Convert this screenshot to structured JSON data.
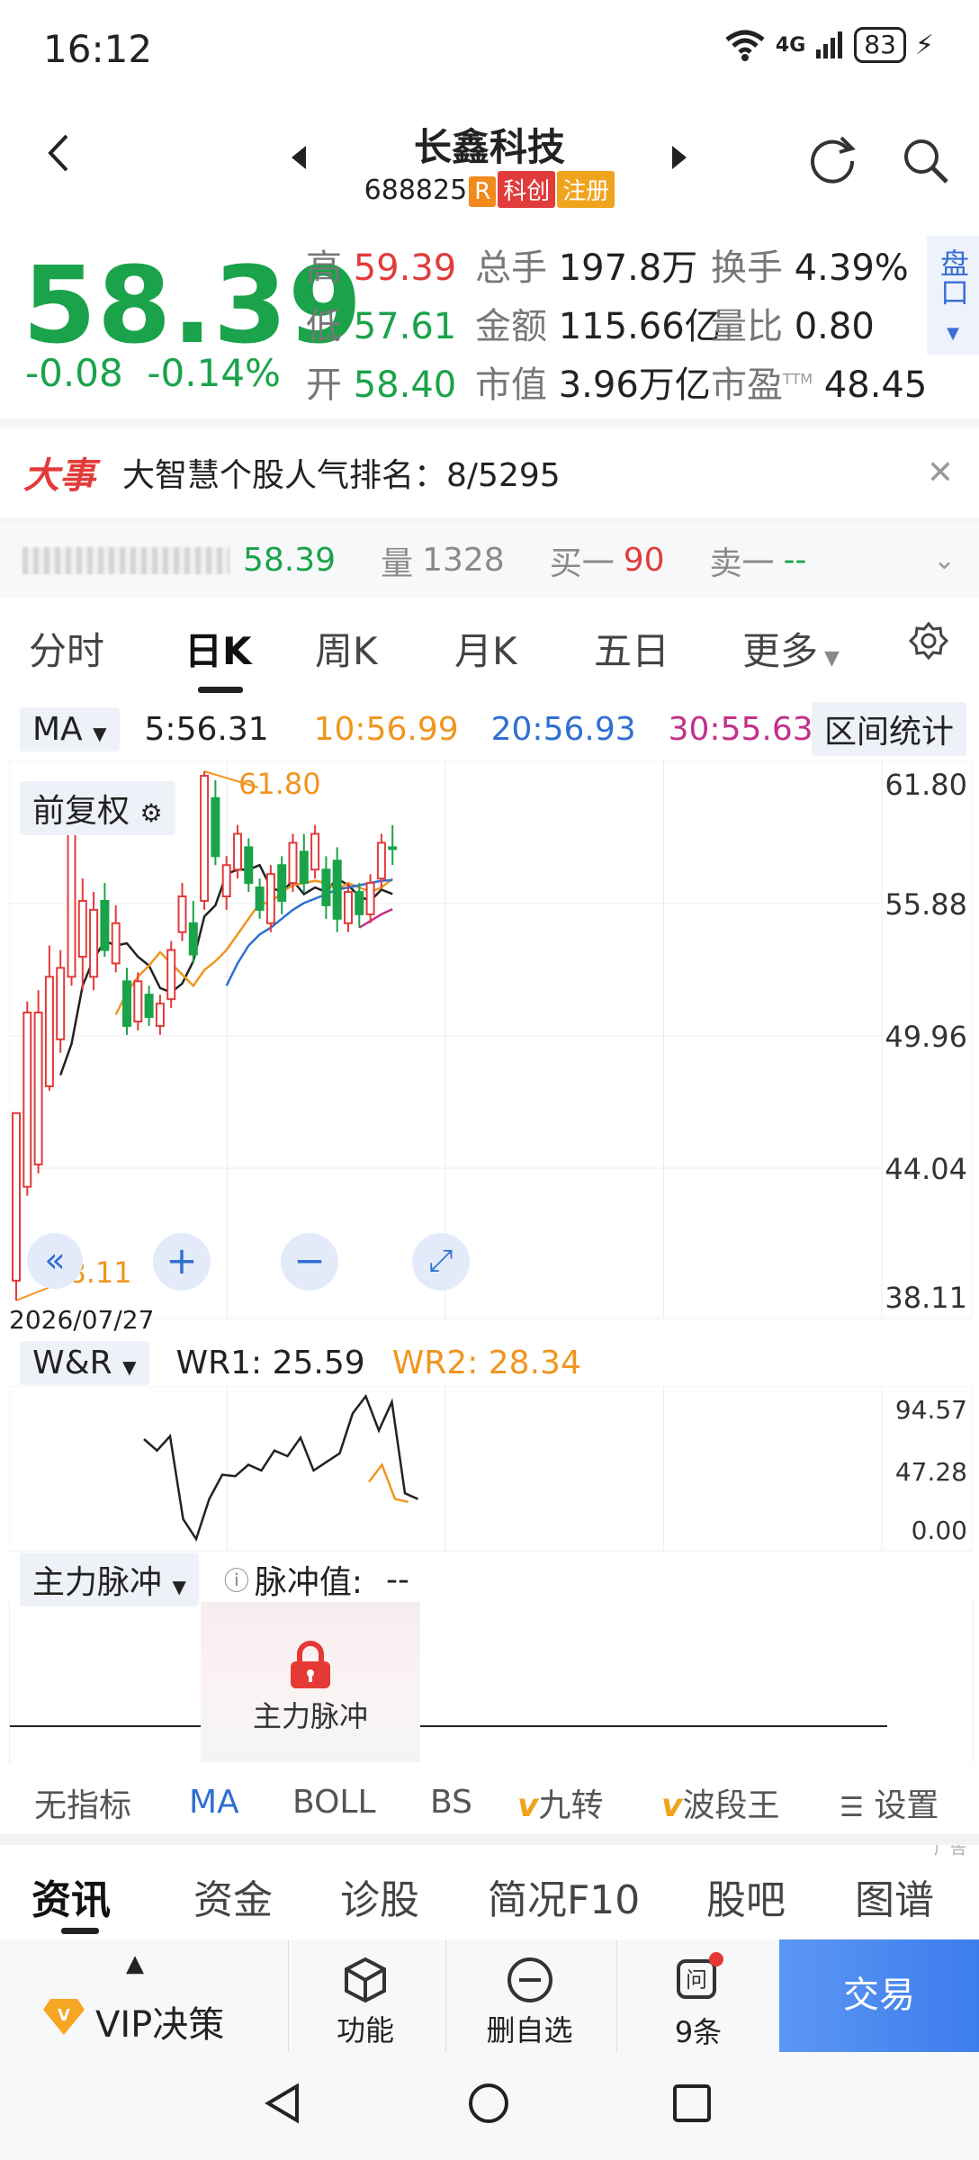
{
  "status": {
    "time": "16:12",
    "signal_top": "6",
    "network": "4G",
    "battery": "83"
  },
  "header": {
    "title": "长鑫科技",
    "code": "688825",
    "tags": [
      "R",
      "科创",
      "注册"
    ]
  },
  "quote": {
    "price": "58.39",
    "change": "-0.08",
    "change_pct": "-0.14%",
    "high_label": "高",
    "high": "59.39",
    "low_label": "低",
    "low": "57.61",
    "open_label": "开",
    "open": "58.40",
    "volume_label": "总手",
    "volume": "197.8万",
    "amount_label": "金额",
    "amount": "115.66亿",
    "mktcap_label": "市值",
    "mktcap": "3.96万亿",
    "turnover_label": "换手",
    "turnover": "4.39%",
    "vol_ratio_label": "量比",
    "vol_ratio": "0.80",
    "pe_label": "市盈",
    "pe_sup": "TTM",
    "pe": "48.45",
    "pankou": "盘口"
  },
  "news": {
    "badge": "大事",
    "text": "大智慧个股人气排名：8/5295"
  },
  "tick": {
    "price": "58.39",
    "vol_label": "量",
    "vol": "1328",
    "buy_label": "买一",
    "buy": "90",
    "sell_label": "卖一",
    "sell": "--"
  },
  "tabs": [
    "分时",
    "日K",
    "周K",
    "月K",
    "五日",
    "更多"
  ],
  "ma_row": {
    "indicator": "MA",
    "ma5": "5:56.31",
    "ma10": "10:56.99",
    "ma20": "20:56.93",
    "ma30": "30:55.63",
    "range_stat": "区间统计"
  },
  "chart": {
    "adjust": "前复权",
    "high_mark": "61.80",
    "low_mark": "38.11",
    "date": "2026/07/27",
    "yticks": [
      "61.80",
      "55.88",
      "49.96",
      "44.04",
      "38.11"
    ]
  },
  "chart_data": {
    "type": "candlestick",
    "ylim": [
      38.11,
      61.8
    ],
    "candles": [
      {
        "o": 39.0,
        "c": 46.5,
        "h": 46.5,
        "l": 38.11
      },
      {
        "o": 43.2,
        "c": 51.0,
        "h": 51.5,
        "l": 42.8
      },
      {
        "o": 44.2,
        "c": 51.0,
        "h": 52.0,
        "l": 43.8
      },
      {
        "o": 47.7,
        "c": 52.6,
        "h": 54.0,
        "l": 47.5
      },
      {
        "o": 49.8,
        "c": 53.0,
        "h": 53.8,
        "l": 49.2
      },
      {
        "o": 52.6,
        "c": 59.0,
        "h": 59.2,
        "l": 52.2
      },
      {
        "o": 53.5,
        "c": 56.0,
        "h": 57.0,
        "l": 52.0
      },
      {
        "o": 52.6,
        "c": 55.6,
        "h": 56.4,
        "l": 52.0
      },
      {
        "o": 56.0,
        "c": 53.8,
        "h": 56.8,
        "l": 53.5
      },
      {
        "o": 53.2,
        "c": 55.0,
        "h": 55.8,
        "l": 52.8
      },
      {
        "o": 52.4,
        "c": 50.4,
        "h": 53.0,
        "l": 50.0
      },
      {
        "o": 50.6,
        "c": 52.4,
        "h": 52.8,
        "l": 50.2
      },
      {
        "o": 51.8,
        "c": 50.8,
        "h": 52.2,
        "l": 50.4
      },
      {
        "o": 50.4,
        "c": 51.4,
        "h": 51.8,
        "l": 50.0
      },
      {
        "o": 51.6,
        "c": 53.8,
        "h": 54.2,
        "l": 51.2
      },
      {
        "o": 54.6,
        "c": 56.2,
        "h": 56.8,
        "l": 54.2
      },
      {
        "o": 55.0,
        "c": 53.6,
        "h": 56.0,
        "l": 53.2
      },
      {
        "o": 56.0,
        "c": 61.6,
        "h": 61.8,
        "l": 55.6
      },
      {
        "o": 60.6,
        "c": 58.0,
        "h": 61.4,
        "l": 57.6
      },
      {
        "o": 56.2,
        "c": 57.6,
        "h": 58.0,
        "l": 55.6
      },
      {
        "o": 57.4,
        "c": 59.0,
        "h": 59.4,
        "l": 57.0
      },
      {
        "o": 58.4,
        "c": 56.8,
        "h": 58.8,
        "l": 56.4
      },
      {
        "o": 56.6,
        "c": 55.6,
        "h": 57.0,
        "l": 55.2
      },
      {
        "o": 55.0,
        "c": 57.2,
        "h": 57.6,
        "l": 54.6
      },
      {
        "o": 57.6,
        "c": 56.0,
        "h": 58.0,
        "l": 55.4
      },
      {
        "o": 56.8,
        "c": 58.6,
        "h": 59.0,
        "l": 56.4
      },
      {
        "o": 58.2,
        "c": 56.8,
        "h": 59.0,
        "l": 56.4
      },
      {
        "o": 57.4,
        "c": 59.0,
        "h": 59.4,
        "l": 57.0
      },
      {
        "o": 57.4,
        "c": 55.8,
        "h": 58.0,
        "l": 55.2
      },
      {
        "o": 57.8,
        "c": 55.2,
        "h": 58.4,
        "l": 54.6
      },
      {
        "o": 55.0,
        "c": 56.4,
        "h": 56.8,
        "l": 54.6
      },
      {
        "o": 56.4,
        "c": 55.4,
        "h": 56.8,
        "l": 54.8
      },
      {
        "o": 55.4,
        "c": 56.8,
        "h": 57.2,
        "l": 55.0
      },
      {
        "o": 57.0,
        "c": 58.6,
        "h": 59.0,
        "l": 56.6
      },
      {
        "o": 58.4,
        "c": 58.39,
        "h": 59.39,
        "l": 57.61
      }
    ],
    "ma5": [
      null,
      null,
      null,
      null,
      48.2,
      49.6,
      52.2,
      53.4,
      54.2,
      54.0,
      54.1,
      53.5,
      53.1,
      52.1,
      51.9,
      52.3,
      53.3,
      55.3,
      55.8,
      57.2,
      57.4,
      57.4,
      57.6,
      56.6,
      56.4,
      56.9,
      56.3,
      56.6,
      56.4,
      57.0,
      56.7,
      56.2,
      56.0,
      56.5,
      56.31
    ],
    "ma10": [
      null,
      null,
      null,
      null,
      null,
      null,
      null,
      null,
      null,
      50.9,
      51.9,
      52.6,
      53.1,
      53.7,
      53.2,
      52.7,
      52.2,
      52.9,
      53.3,
      53.8,
      54.5,
      55.2,
      55.9,
      55.9,
      56.4,
      56.7,
      56.8,
      56.9,
      56.8,
      56.5,
      56.8,
      56.6,
      56.4,
      56.6,
      56.99
    ],
    "ma20": [
      null,
      null,
      null,
      null,
      null,
      null,
      null,
      null,
      null,
      null,
      null,
      null,
      null,
      null,
      null,
      null,
      null,
      null,
      null,
      52.2,
      53.2,
      54.0,
      54.5,
      54.8,
      55.2,
      55.6,
      55.9,
      56.1,
      56.3,
      56.5,
      56.6,
      56.7,
      56.8,
      56.9,
      56.93
    ],
    "ma30": [
      null,
      null,
      null,
      null,
      null,
      null,
      null,
      null,
      null,
      null,
      null,
      null,
      null,
      null,
      null,
      null,
      null,
      null,
      null,
      null,
      null,
      null,
      null,
      null,
      null,
      null,
      null,
      null,
      null,
      null,
      null,
      54.8,
      55.1,
      55.4,
      55.63
    ],
    "wr": {
      "label": "W&R",
      "wr1_label": "WR1: ",
      "wr1": "25.59",
      "wr2_label": "WR2: ",
      "wr2": "28.34",
      "yticks": [
        "94.57",
        "47.28",
        "0.00"
      ],
      "ylim": [
        0,
        94.57
      ]
    }
  },
  "pulse": {
    "label": "主力脉冲",
    "value_label": "脉冲值:",
    "value": "--",
    "lock_text": "主力脉冲"
  },
  "indicators": [
    "无指标",
    "MA",
    "BOLL",
    "BS",
    "九转",
    "波段王",
    "设置"
  ],
  "ad": "广告",
  "info_tabs": [
    "资讯",
    "资金",
    "诊股",
    "简况F10",
    "股吧",
    "图谱"
  ],
  "bottom": {
    "vip": "VIP决策",
    "func": "功能",
    "del": "删自选",
    "ask": "9条",
    "trade": "交易"
  },
  "colors": {
    "green": "#1aa34a",
    "red": "#e23b3b",
    "orange": "#f0951e",
    "blue": "#2f6fd1",
    "magenta": "#c2308a",
    "trade_blue": "#4f8ff0"
  }
}
